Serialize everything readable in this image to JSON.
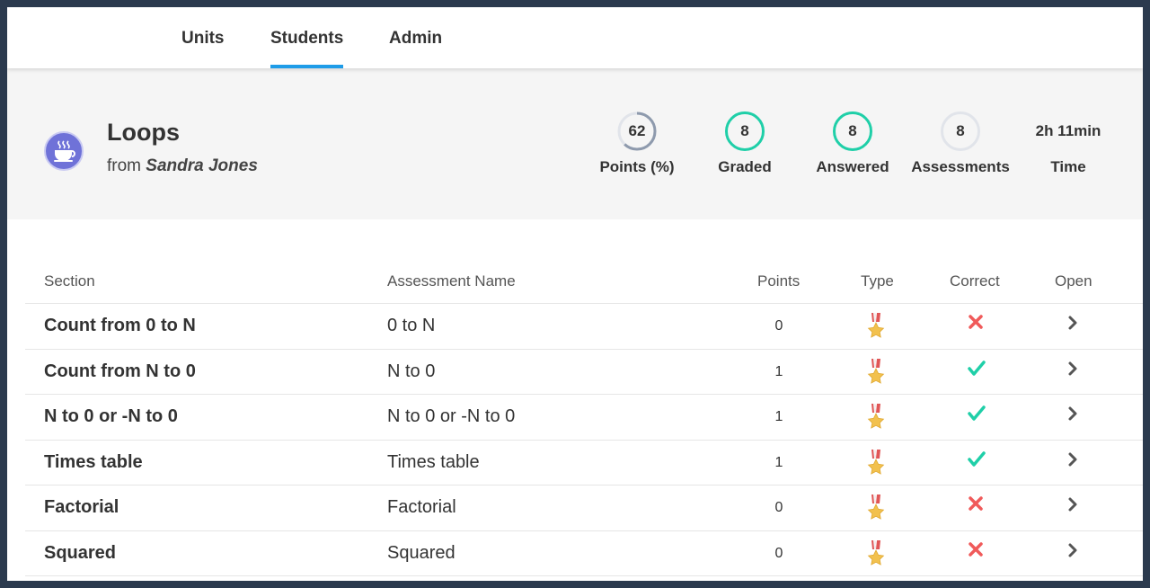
{
  "nav": {
    "tabs": [
      {
        "label": "Units"
      },
      {
        "label": "Students"
      },
      {
        "label": "Admin"
      }
    ],
    "active": "Students",
    "accent": "#1e9ce8"
  },
  "course": {
    "title": "Loops",
    "from_prefix": "from",
    "author": "Sandra Jones",
    "icon": "coffee-cup-icon"
  },
  "stats": {
    "points": {
      "value": "62",
      "label": "Points (%)",
      "progress": 0.62
    },
    "graded": {
      "value": "8",
      "label": "Graded"
    },
    "answered": {
      "value": "8",
      "label": "Answered"
    },
    "assessments": {
      "value": "8",
      "label": "Assessments"
    },
    "time": {
      "value": "2h 11min",
      "label": "Time"
    }
  },
  "table": {
    "headers": {
      "section": "Section",
      "name": "Assessment Name",
      "points": "Points",
      "type": "Type",
      "correct": "Correct",
      "open": "Open"
    },
    "rows": [
      {
        "section": "Count from 0 to N",
        "name": "0 to N",
        "points": "0",
        "correct": false
      },
      {
        "section": "Count from N to 0",
        "name": "N to 0",
        "points": "1",
        "correct": true
      },
      {
        "section": "N to 0 or -N to 0",
        "name": "N to 0 or -N to 0",
        "points": "1",
        "correct": true
      },
      {
        "section": "Times table",
        "name": "Times table",
        "points": "1",
        "correct": true
      },
      {
        "section": "Factorial",
        "name": "Factorial",
        "points": "0",
        "correct": false
      },
      {
        "section": "Squared",
        "name": "Squared",
        "points": "0",
        "correct": false
      }
    ],
    "type_icon": "medal-icon",
    "correct_icon": "checkmark-icon",
    "wrong_icon": "cross-icon",
    "open_icon": "chevron-right-icon",
    "colors": {
      "correct": "#1fcfa8",
      "wrong": "#f05a5a"
    }
  }
}
